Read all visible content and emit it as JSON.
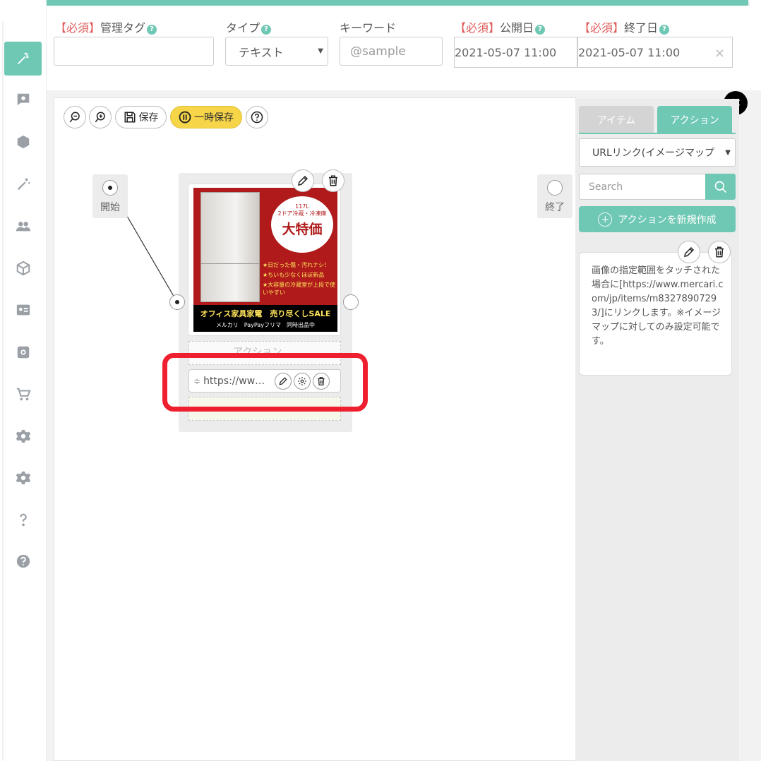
{
  "filters": {
    "tag": {
      "required": "【必須】",
      "label": "管理タグ",
      "value": ""
    },
    "type": {
      "label": "タイプ",
      "value": "テキスト"
    },
    "keyword": {
      "label": "キーワード",
      "placeholder": "@sample"
    },
    "publish": {
      "required": "【必須】",
      "label": "公開日",
      "value": "2021-05-07 11:00"
    },
    "end": {
      "required": "【必須】",
      "label": "終了日",
      "value": "2021-05-07 11:00"
    },
    "help_mark": "?"
  },
  "toolbar": {
    "save_label": "保存",
    "temp_save_label": "一時保存",
    "help_mark": "?"
  },
  "flow": {
    "start_label": "開始",
    "end_label": "終了",
    "slot_placeholder": "アクション",
    "action_url": "https://www.mercari.com/jp/items/m83278907293/"
  },
  "ad_image": {
    "bubble_small": "117L\n2ドア冷蔵・冷凍庫",
    "bubble_big": "大特価",
    "features": [
      "★日だった傷・汚れナシ！",
      "★ちいも少なくほぼ新品",
      "★大容量の冷蔵室が上段で使いやすい"
    ],
    "band_line1": "オフィス家具家電　売り尽くしSALE",
    "band_line2": "メルカリ　PayPayフリマ　同時出品中"
  },
  "panel": {
    "tabs": [
      {
        "label": "アイテム"
      },
      {
        "label": "アクション"
      }
    ],
    "select_value": "URLリンク(イメージマップ",
    "search_placeholder": "Search",
    "new_action_label": "アクションを新規作成",
    "description": "画像の指定範囲をタッチされた場合に[https://www.mercari.com/jp/items/m83278907293/]にリンクします。※イメージマップに対してのみ設定可能です。"
  },
  "close_symbol": "✖",
  "colors": {
    "accent": "#6fc8b4",
    "required": "#e05b5b",
    "highlight": "#ee2030",
    "temp_save": "#f7d548"
  }
}
